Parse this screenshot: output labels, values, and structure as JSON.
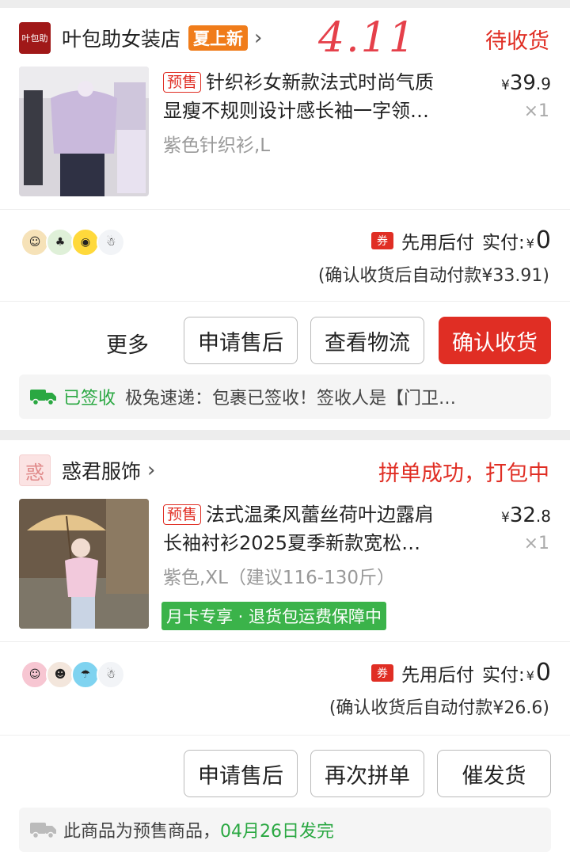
{
  "orders": [
    {
      "shop": {
        "logo_text": "叶包助",
        "name": "叶包助女装店",
        "tag": "夏上新"
      },
      "handwritten_note": "4.11",
      "status": "待收货",
      "product": {
        "presale_label": "预售",
        "title_line1": "针织衫女新款法式时尚气质",
        "title_line2": "显瘦不规则设计感长袖一字领…",
        "variant": "紫色针织衫,L",
        "price_currency": "¥",
        "price_int": "39",
        "price_dec": ".9",
        "quantity": "×1"
      },
      "payment": {
        "coupon_icon": "券",
        "method": "先用后付",
        "paid_label": "实付:",
        "paid_currency": "¥",
        "paid_amount": "0",
        "auto_pay_note": "(确认收货后自动付款¥33.91)"
      },
      "actions": {
        "more": "更多",
        "btn1": "申请售后",
        "btn2": "查看物流",
        "btn3": "确认收货"
      },
      "logistics": {
        "signed": "已签收",
        "text": "极兔速递：包裹已签收！签收人是【门卫…"
      }
    },
    {
      "shop": {
        "logo_text": "惑",
        "name": "惑君服饰"
      },
      "status": "拼单成功，打包中",
      "product": {
        "presale_label": "预售",
        "title_line1": "法式温柔风蕾丝荷叶边露肩",
        "title_line2": "长袖衬衫2025夏季新款宽松…",
        "variant": "紫色,XL（建议116-130斤）",
        "badge": "月卡专享 · 退货包运费保障中",
        "price_currency": "¥",
        "price_int": "32",
        "price_dec": ".8",
        "quantity": "×1"
      },
      "payment": {
        "coupon_icon": "券",
        "method": "先用后付",
        "paid_label": "实付:",
        "paid_currency": "¥",
        "paid_amount": "0",
        "auto_pay_note": "(确认收货后自动付款¥26.6)"
      },
      "actions": {
        "btn1": "申请售后",
        "btn2": "再次拼单",
        "btn3": "催发货"
      },
      "logistics": {
        "text": "此商品为预售商品，",
        "ship_date": "04月26日发完"
      }
    }
  ],
  "colors": {
    "accent_red": "#e02e24",
    "green": "#2aa842",
    "tag_orange": "#f07c1a"
  }
}
